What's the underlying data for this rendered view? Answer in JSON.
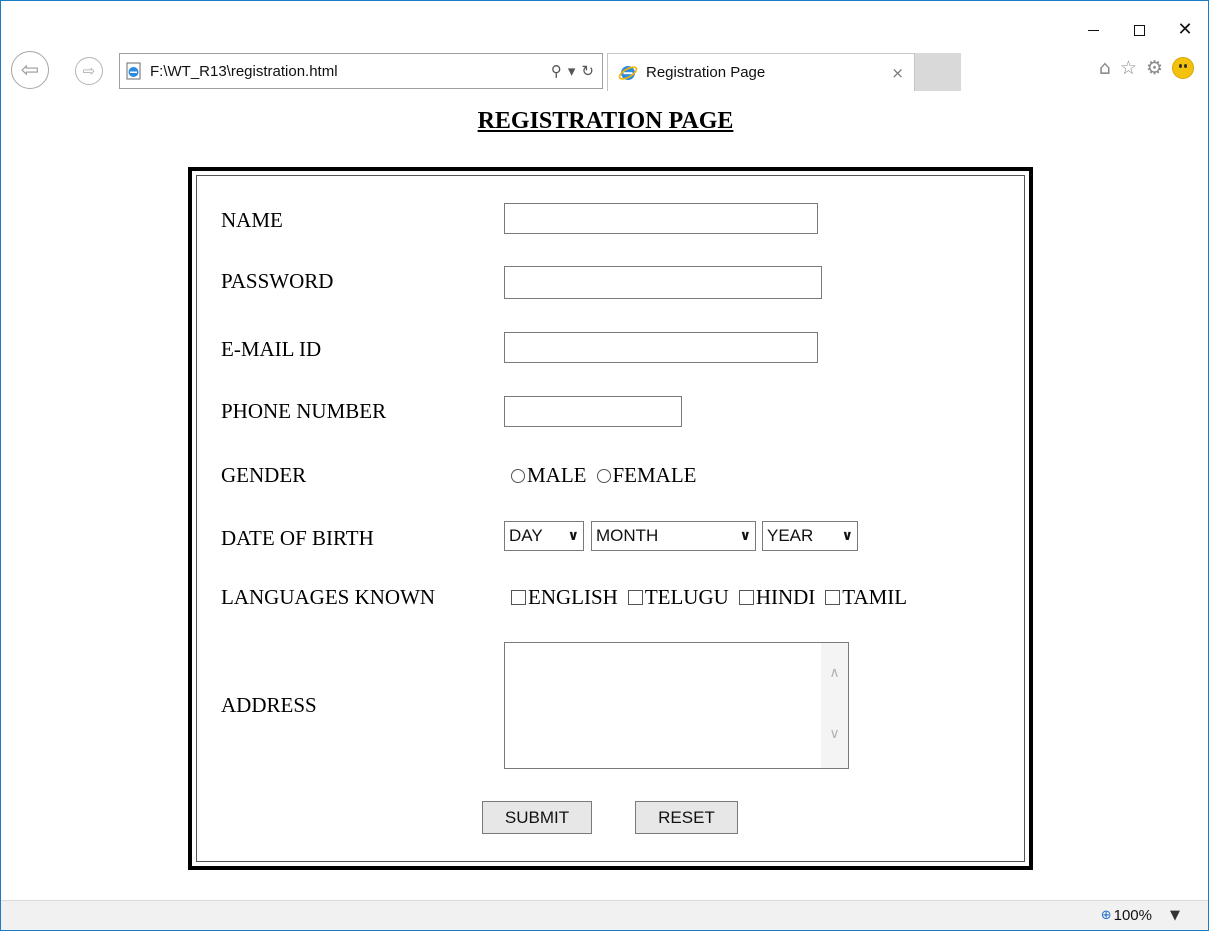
{
  "window_controls": {
    "minimize": "minimize",
    "maximize": "maximize",
    "close": "✕"
  },
  "browser": {
    "address": "F:\\WT_R13\\registration.html",
    "tab_title": "Registration Page",
    "tab_close": "×",
    "toolbar_icons": [
      "home-icon",
      "favorites-icon",
      "settings-icon",
      "feedback-icon"
    ]
  },
  "page": {
    "heading": "REGISTRATION PAGE",
    "fields": {
      "name": {
        "label": "NAME",
        "value": ""
      },
      "password": {
        "label": "PASSWORD",
        "value": ""
      },
      "email": {
        "label": "E-MAIL ID",
        "value": ""
      },
      "phone": {
        "label": "PHONE NUMBER",
        "value": ""
      },
      "gender": {
        "label": "GENDER",
        "options": [
          "MALE",
          "FEMALE"
        ]
      },
      "dob": {
        "label": "DATE OF BIRTH",
        "day": "DAY",
        "month": "MONTH",
        "year": "YEAR"
      },
      "languages": {
        "label": "LANGUAGES KNOWN",
        "options": [
          "ENGLISH",
          "TELUGU",
          "HINDI",
          "TAMIL"
        ]
      },
      "address": {
        "label": "ADDRESS",
        "value": ""
      }
    },
    "buttons": {
      "submit": "SUBMIT",
      "reset": "RESET"
    }
  },
  "status": {
    "zoom": "100%"
  }
}
